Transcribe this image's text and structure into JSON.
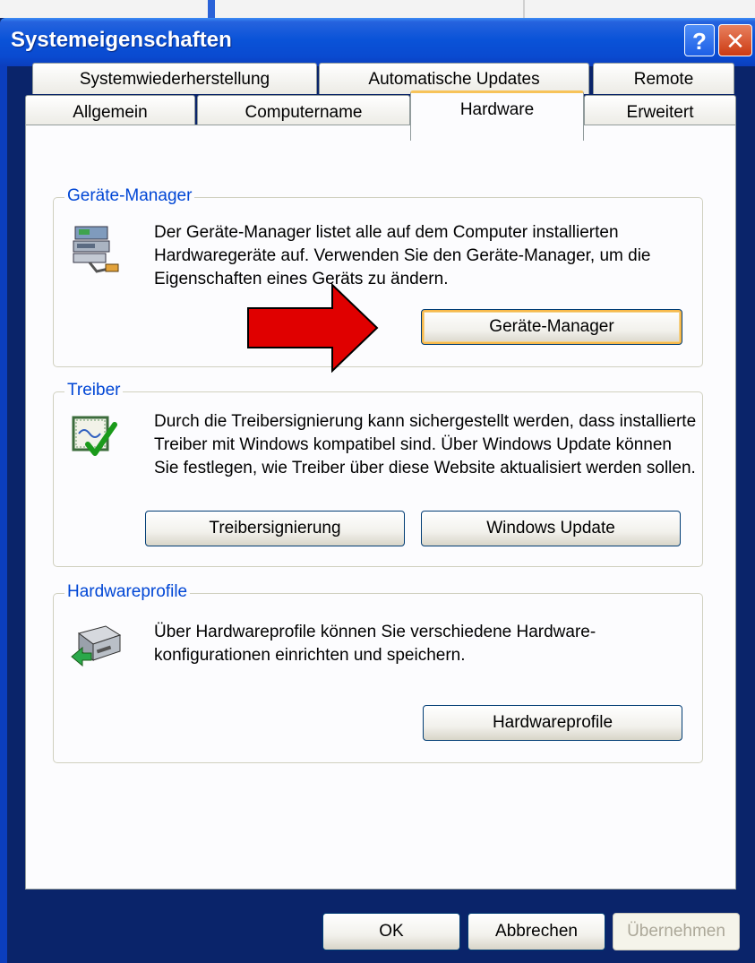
{
  "window": {
    "title": "Systemeigenschaften",
    "help_button": "?",
    "close_button": "✕"
  },
  "tabs": {
    "row1": [
      "Systemwiederherstellung",
      "Automatische Updates",
      "Remote"
    ],
    "row2": [
      "Allgemein",
      "Computername",
      "Hardware",
      "Erweitert"
    ],
    "active": "Hardware"
  },
  "device_manager": {
    "group_label": "Geräte-Manager",
    "description": "Der Geräte-Manager listet alle auf dem Computer installierten Hardwaregeräte auf. Verwenden Sie den Geräte-Manager, um die Eigenschaften eines Geräts zu ändern.",
    "button": "Geräte-Manager"
  },
  "drivers": {
    "group_label": "Treiber",
    "description": "Durch die Treibersignierung kann sichergestellt werden, dass installierte Treiber mit Windows kompatibel sind. Über Windows Update können Sie festlegen, wie Treiber über diese Website aktualisiert werden sollen.",
    "signing_button": "Treibersignierung",
    "update_button": "Windows Update"
  },
  "profiles": {
    "group_label": "Hardwareprofile",
    "description": "Über Hardwareprofile können Sie verschiedene Hardware-konfigurationen einrichten und speichern.",
    "button": "Hardwareprofile"
  },
  "footer": {
    "ok": "OK",
    "cancel": "Abbrechen",
    "apply": "Übernehmen"
  },
  "colors": {
    "titlebar": "#0a53d8",
    "group_label": "#0046d5",
    "arrow": "#e00000",
    "focus": "#f8b94a"
  }
}
